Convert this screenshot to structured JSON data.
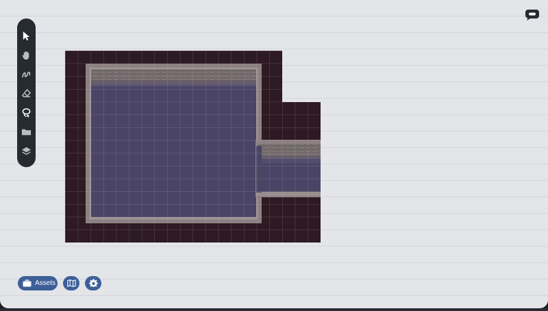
{
  "toolbar": {
    "tools": [
      {
        "name": "select",
        "icon": "cursor-arrow-icon",
        "active": true
      },
      {
        "name": "pan",
        "icon": "hand-icon",
        "active": false
      },
      {
        "name": "draw",
        "icon": "squiggle-icon",
        "active": false
      },
      {
        "name": "erase",
        "icon": "eraser-icon",
        "active": false
      },
      {
        "name": "fog",
        "icon": "lasso-icon",
        "active": false
      },
      {
        "name": "folder",
        "icon": "folder-icon",
        "active": false
      },
      {
        "name": "layers",
        "icon": "layers-icon",
        "active": false
      }
    ]
  },
  "bottom_bar": {
    "assets_label": "Assets",
    "assets_icon": "toolbox-icon",
    "map_icon": "map-icon",
    "settings_icon": "gear-icon"
  },
  "chat": {
    "icon": "speech-bubble-icon"
  },
  "colors": {
    "background": "#e3e5e8",
    "toolbar": "#252b31",
    "button": "#3d5f99",
    "void": "#2d1a22",
    "floor": "#4a4566",
    "wall": "#8a7f80"
  }
}
